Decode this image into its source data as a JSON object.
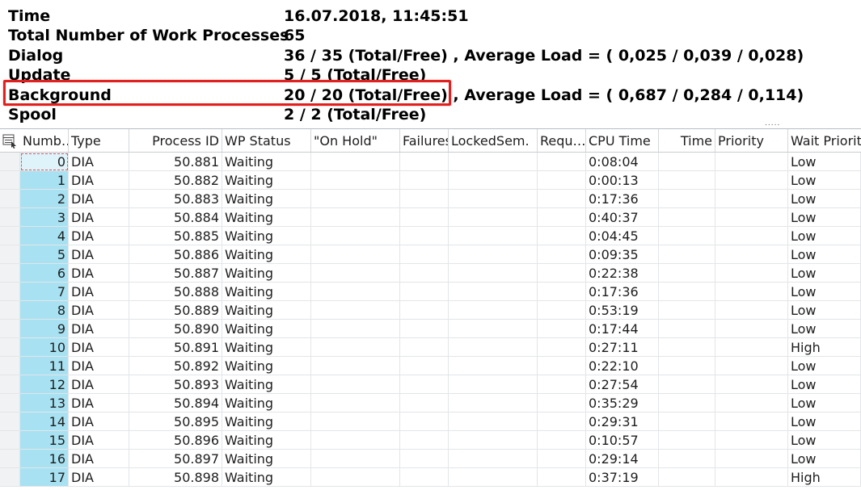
{
  "header": {
    "rows": [
      {
        "label": "Time",
        "value": "16.07.2018, 11:45:51"
      },
      {
        "label": "Total Number of Work Processes",
        "value": "65"
      },
      {
        "label": "Dialog",
        "value": "36 / 35 (Total/Free) , Average Load = ( 0,025 / 0,039 / 0,028)"
      },
      {
        "label": "Update",
        "value": "5 / 5 (Total/Free)"
      },
      {
        "label": "Background",
        "value": "20 / 20 (Total/Free) , Average Load = ( 0,687 / 0,284 / 0,114)"
      },
      {
        "label": "Spool",
        "value": "2 / 2 (Total/Free)"
      }
    ],
    "highlight_color": "#e0201e"
  },
  "table": {
    "columns": [
      "Numb…",
      "Type",
      "Process ID",
      "WP Status",
      "\"On Hold\"",
      "Failures",
      "LockedSem.",
      "Requ…",
      "CPU Time",
      "Time",
      "Priority",
      "Wait Priority"
    ],
    "rows": [
      {
        "num": "0",
        "type": "DIA",
        "pid": "50.881",
        "status": "Waiting",
        "cpu": "0:08:04",
        "wait": "Low"
      },
      {
        "num": "1",
        "type": "DIA",
        "pid": "50.882",
        "status": "Waiting",
        "cpu": "0:00:13",
        "wait": "Low"
      },
      {
        "num": "2",
        "type": "DIA",
        "pid": "50.883",
        "status": "Waiting",
        "cpu": "0:17:36",
        "wait": "Low"
      },
      {
        "num": "3",
        "type": "DIA",
        "pid": "50.884",
        "status": "Waiting",
        "cpu": "0:40:37",
        "wait": "Low"
      },
      {
        "num": "4",
        "type": "DIA",
        "pid": "50.885",
        "status": "Waiting",
        "cpu": "0:04:45",
        "wait": "Low"
      },
      {
        "num": "5",
        "type": "DIA",
        "pid": "50.886",
        "status": "Waiting",
        "cpu": "0:09:35",
        "wait": "Low"
      },
      {
        "num": "6",
        "type": "DIA",
        "pid": "50.887",
        "status": "Waiting",
        "cpu": "0:22:38",
        "wait": "Low"
      },
      {
        "num": "7",
        "type": "DIA",
        "pid": "50.888",
        "status": "Waiting",
        "cpu": "0:17:36",
        "wait": "Low"
      },
      {
        "num": "8",
        "type": "DIA",
        "pid": "50.889",
        "status": "Waiting",
        "cpu": "0:53:19",
        "wait": "Low"
      },
      {
        "num": "9",
        "type": "DIA",
        "pid": "50.890",
        "status": "Waiting",
        "cpu": "0:17:44",
        "wait": "Low"
      },
      {
        "num": "10",
        "type": "DIA",
        "pid": "50.891",
        "status": "Waiting",
        "cpu": "0:27:11",
        "wait": "High"
      },
      {
        "num": "11",
        "type": "DIA",
        "pid": "50.892",
        "status": "Waiting",
        "cpu": "0:22:10",
        "wait": "Low"
      },
      {
        "num": "12",
        "type": "DIA",
        "pid": "50.893",
        "status": "Waiting",
        "cpu": "0:27:54",
        "wait": "Low"
      },
      {
        "num": "13",
        "type": "DIA",
        "pid": "50.894",
        "status": "Waiting",
        "cpu": "0:35:29",
        "wait": "Low"
      },
      {
        "num": "14",
        "type": "DIA",
        "pid": "50.895",
        "status": "Waiting",
        "cpu": "0:29:31",
        "wait": "Low"
      },
      {
        "num": "15",
        "type": "DIA",
        "pid": "50.896",
        "status": "Waiting",
        "cpu": "0:10:57",
        "wait": "Low"
      },
      {
        "num": "16",
        "type": "DIA",
        "pid": "50.897",
        "status": "Waiting",
        "cpu": "0:29:14",
        "wait": "Low"
      },
      {
        "num": "17",
        "type": "DIA",
        "pid": "50.898",
        "status": "Waiting",
        "cpu": "0:37:19",
        "wait": "High"
      }
    ],
    "number_column_color": "#a8e2f2"
  },
  "icons": {
    "selector": "column-selector-icon",
    "splitter": "splitter-dots"
  }
}
